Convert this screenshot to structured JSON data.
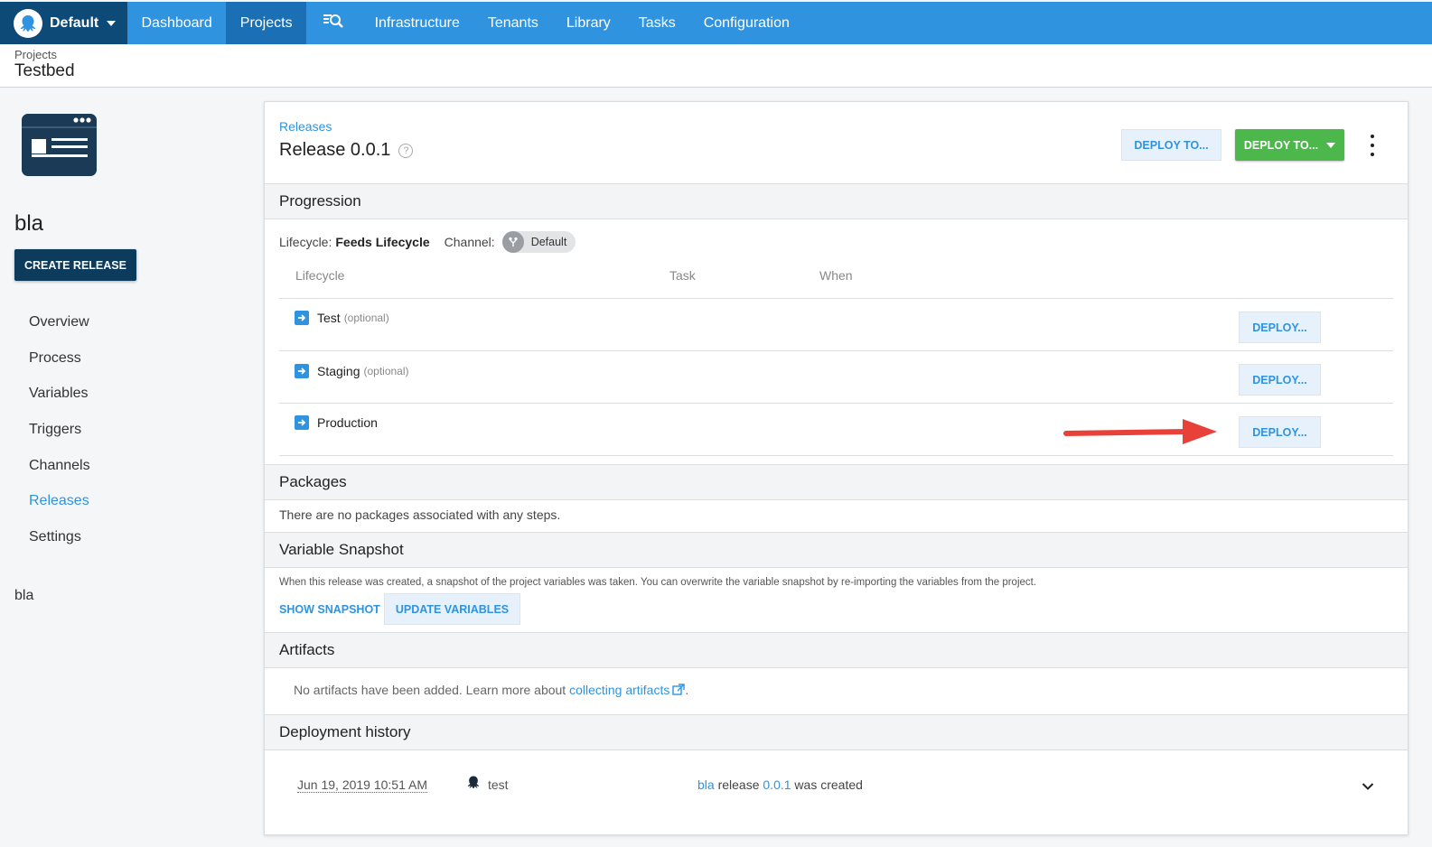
{
  "topnav": {
    "space_label": "Default",
    "items": [
      {
        "label": "Dashboard"
      },
      {
        "label": "Projects"
      },
      {
        "label": "Infrastructure"
      },
      {
        "label": "Tenants"
      },
      {
        "label": "Library"
      },
      {
        "label": "Tasks"
      },
      {
        "label": "Configuration"
      }
    ],
    "nav_color": "#2f93e0",
    "active_color": "#1a6fb5"
  },
  "header": {
    "breadcrumb": "Projects",
    "title": "Testbed"
  },
  "sidebar": {
    "project_name": "bla",
    "create_release_label": "CREATE RELEASE",
    "items": [
      {
        "label": "Overview"
      },
      {
        "label": "Process"
      },
      {
        "label": "Variables"
      },
      {
        "label": "Triggers"
      },
      {
        "label": "Channels"
      },
      {
        "label": "Releases",
        "active": true
      },
      {
        "label": "Settings"
      }
    ],
    "footer_text": "bla"
  },
  "release": {
    "breadcrumb": "Releases",
    "title": "Release 0.0.1",
    "deploy_to_label": "DEPLOY TO...",
    "deploy_to_green_label": "DEPLOY TO..."
  },
  "progression": {
    "heading": "Progression",
    "lifecycle_label": "Lifecycle:",
    "lifecycle_value": "Feeds Lifecycle",
    "channel_label": "Channel:",
    "channel_value": "Default",
    "columns": [
      "Lifecycle",
      "Task",
      "When"
    ],
    "environments": [
      {
        "name": "Test",
        "optional": "(optional)",
        "deploy_label": "DEPLOY..."
      },
      {
        "name": "Staging",
        "optional": "(optional)",
        "deploy_label": "DEPLOY..."
      },
      {
        "name": "Production",
        "optional": "",
        "deploy_label": "DEPLOY..."
      }
    ]
  },
  "packages": {
    "heading": "Packages",
    "empty_text": "There are no packages associated with any steps."
  },
  "variable_snapshot": {
    "heading": "Variable Snapshot",
    "description": "When this release was created, a snapshot of the project variables was taken. You can overwrite the variable snapshot by re-importing the variables from the project.",
    "show_snapshot_label": "SHOW SNAPSHOT",
    "update_variables_label": "UPDATE VARIABLES"
  },
  "artifacts": {
    "heading": "Artifacts",
    "text_before": "No artifacts have been added. Learn more about",
    "link_text": "collecting artifacts",
    "text_after": "."
  },
  "deployment_history": {
    "heading": "Deployment history",
    "entries": [
      {
        "date": "Jun 19, 2019 10:51 AM",
        "user": "test",
        "project_link": "bla",
        "middle_text": "release",
        "version_link": "0.0.1",
        "end_text": "was created"
      }
    ]
  },
  "colors": {
    "accent": "#2f93e0",
    "success": "#4cb84c",
    "dark_navy": "#0d3b5c",
    "annotation_arrow": "#e8413a"
  }
}
